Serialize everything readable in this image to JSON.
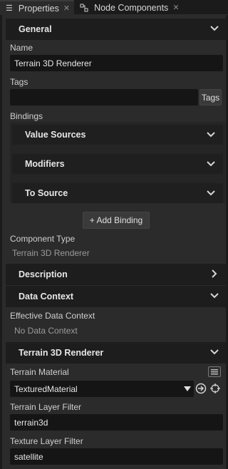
{
  "tabs": [
    {
      "label": "Properties",
      "icon": "list-icon",
      "active": true
    },
    {
      "label": "Node Components",
      "icon": "components-icon",
      "active": false
    }
  ],
  "general": {
    "header": "General",
    "name_label": "Name",
    "name_value": "Terrain 3D Renderer",
    "tags_label": "Tags",
    "tags_value": "",
    "tags_button": "Tags",
    "bindings_label": "Bindings",
    "binding_groups": [
      "Value Sources",
      "Modifiers",
      "To Source"
    ],
    "add_binding": "+ Add Binding",
    "component_type_label": "Component Type",
    "component_type_value": "Terrain 3D Renderer"
  },
  "description": {
    "header": "Description"
  },
  "data_context": {
    "header": "Data Context",
    "effective_label": "Effective Data Context",
    "effective_value": "No Data Context"
  },
  "terrain": {
    "header": "Terrain 3D Renderer",
    "material_label": "Terrain Material",
    "material_value": "TexturedMaterial",
    "terrain_filter_label": "Terrain Layer Filter",
    "terrain_filter_value": "terrain3d",
    "texture_filter_label": "Texture Layer Filter",
    "texture_filter_value": "satellite"
  },
  "colors": {
    "background": "#2b2b2b",
    "field": "#151515",
    "header": "#1d1d1d"
  }
}
